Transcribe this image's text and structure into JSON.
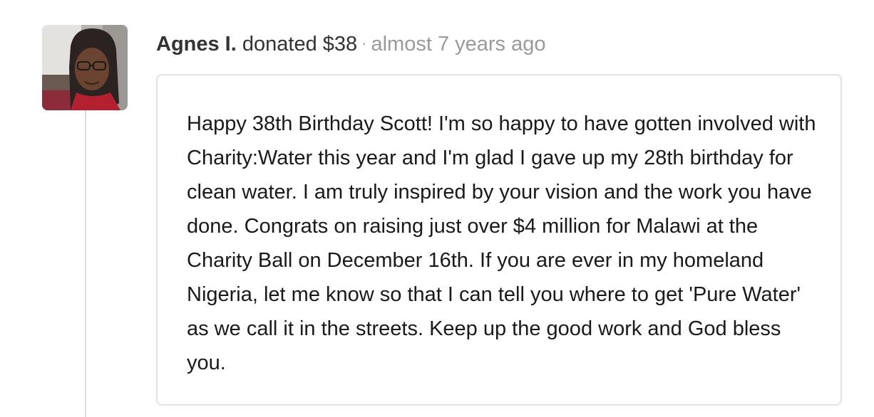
{
  "donation": {
    "donor_name": "Agnes I.",
    "action_text": "donated $38",
    "separator": "·",
    "time_ago": "almost 7 years ago",
    "message": "Happy 38th Birthday Scott! I'm so happy to have gotten involved with Charity:Water this year and I'm glad I gave up my 28th birthday for clean water. I am truly inspired by your vision and the work you have done. Congrats on raising just over $4 million for Malawi at the Charity Ball on December 16th. If you are ever in my homeland Nigeria, let me know so that I can tell you where to get 'Pure Water' as we call it in the streets. Keep up the good work and God bless you."
  },
  "colors": {
    "name_text": "#333333",
    "muted_text": "#9a9a9a",
    "card_border": "#e3e3e3",
    "timeline_line": "#dcdcdc"
  }
}
